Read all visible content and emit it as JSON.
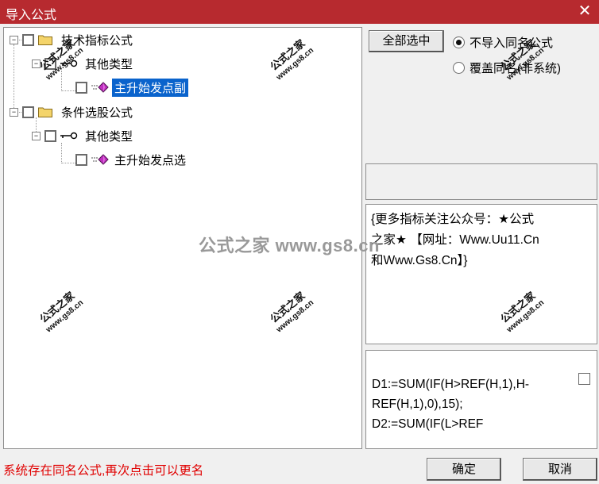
{
  "window": {
    "title": "导入公式",
    "close_glyph": "✕"
  },
  "tree": {
    "nodes": [
      {
        "label": "技术指标公式",
        "expander": "−"
      },
      {
        "label": "其他类型",
        "expander": "−"
      },
      {
        "label": "主升始发点副",
        "selected": true
      },
      {
        "label": "条件选股公式",
        "expander": "−"
      },
      {
        "label": "其他类型",
        "expander": "−"
      },
      {
        "label": "主升始发点选"
      }
    ]
  },
  "options": {
    "select_all_label": "全部选中",
    "radio_skip_label": "不导入同名公式",
    "radio_overwrite_label": "覆盖同名(非系统)",
    "selected": "skip"
  },
  "description": {
    "line1": "{更多指标关注公众号：★公式",
    "line2": "之家★ 【网址：Www.Uu11.Cn",
    "line3": "和Www.Gs8.Cn】}"
  },
  "code": {
    "line1": "D1:=SUM(IF(H>REF(H,1),H-",
    "line2": "REF(H,1),0),15);",
    "line3": "D2:=SUM(IF(L>REF"
  },
  "status": {
    "message": "系统存在同名公式,再次点击可以更名"
  },
  "buttons": {
    "ok_label": "确定",
    "cancel_label": "取消"
  },
  "watermark": {
    "main": "公式之家",
    "sub": "www.gs8.cn",
    "center": "公式之家 www.gs8.cn"
  },
  "colors": {
    "titlebar": "#b72a2f",
    "selection": "#0a63cc",
    "status_text": "#e00000"
  }
}
